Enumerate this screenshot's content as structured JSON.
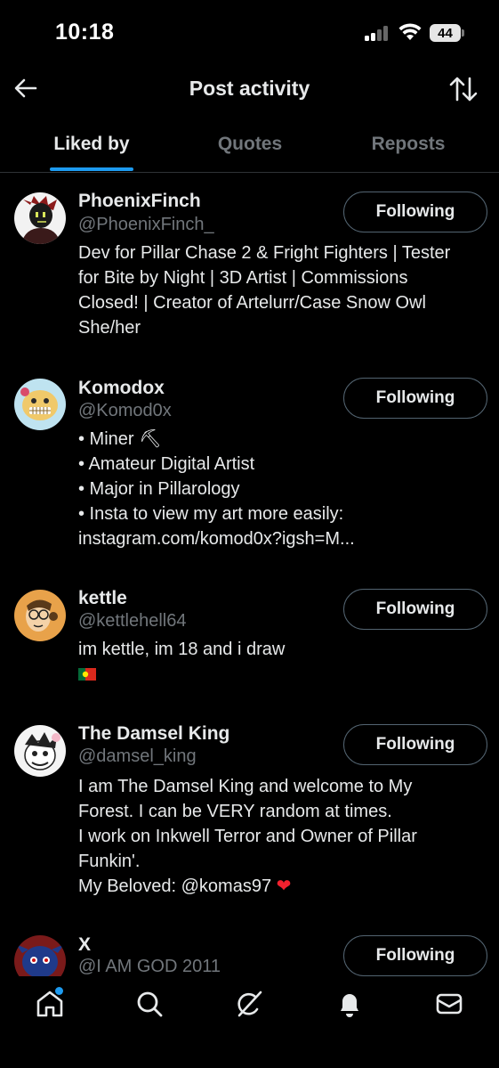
{
  "status_bar": {
    "time": "10:18",
    "battery": "44"
  },
  "header": {
    "title": "Post activity"
  },
  "tabs": [
    {
      "label": "Liked by",
      "active": true
    },
    {
      "label": "Quotes",
      "active": false
    },
    {
      "label": "Reposts",
      "active": false
    }
  ],
  "users": [
    {
      "name": "PhoenixFinch",
      "handle": "@PhoenixFinch_",
      "bio": [
        "Dev for Pillar Chase 2 & Fright Fighters | Tester",
        "for Bite by Night | 3D Artist | Commissions",
        "Closed! | Creator of Artelurr/Case Snow Owl",
        "She/her"
      ],
      "button": "Following"
    },
    {
      "name": "Komodox",
      "handle": "@Komod0x",
      "bio": [
        "• Miner ⛏",
        "• Amateur Digital Artist",
        "• Major in Pillarology",
        "• Insta to view my art more easily:",
        "instagram.com/komod0x?igsh=M..."
      ],
      "button": "Following"
    },
    {
      "name": "kettle",
      "handle": "@kettlehell64",
      "bio": [
        "im kettle, im 18 and i draw"
      ],
      "button": "Following"
    },
    {
      "name": "The Damsel King",
      "handle": "@damsel_king",
      "bio": [
        "I am The Damsel King and welcome to My",
        "Forest. I can be VERY random at times.",
        "I work on Inkwell Terror and Owner of Pillar",
        "Funkin'.",
        "My Beloved: @komas97 ❤"
      ],
      "button": "Following"
    },
    {
      "name": "X",
      "handle": "@I AM GOD 2011",
      "bio": [],
      "button": "Following"
    }
  ],
  "colors": {
    "background": "#000000",
    "text": "#e7e9ea",
    "secondary_text": "#71767b",
    "accent": "#1d9bf0",
    "button_border": "#536471",
    "heart": "#f4212e"
  },
  "icons": {
    "back": "arrow-left-icon",
    "sort": "sort-arrows-icon",
    "nav": [
      "home-icon",
      "search-icon",
      "grok-icon",
      "notifications-icon",
      "messages-icon"
    ]
  }
}
